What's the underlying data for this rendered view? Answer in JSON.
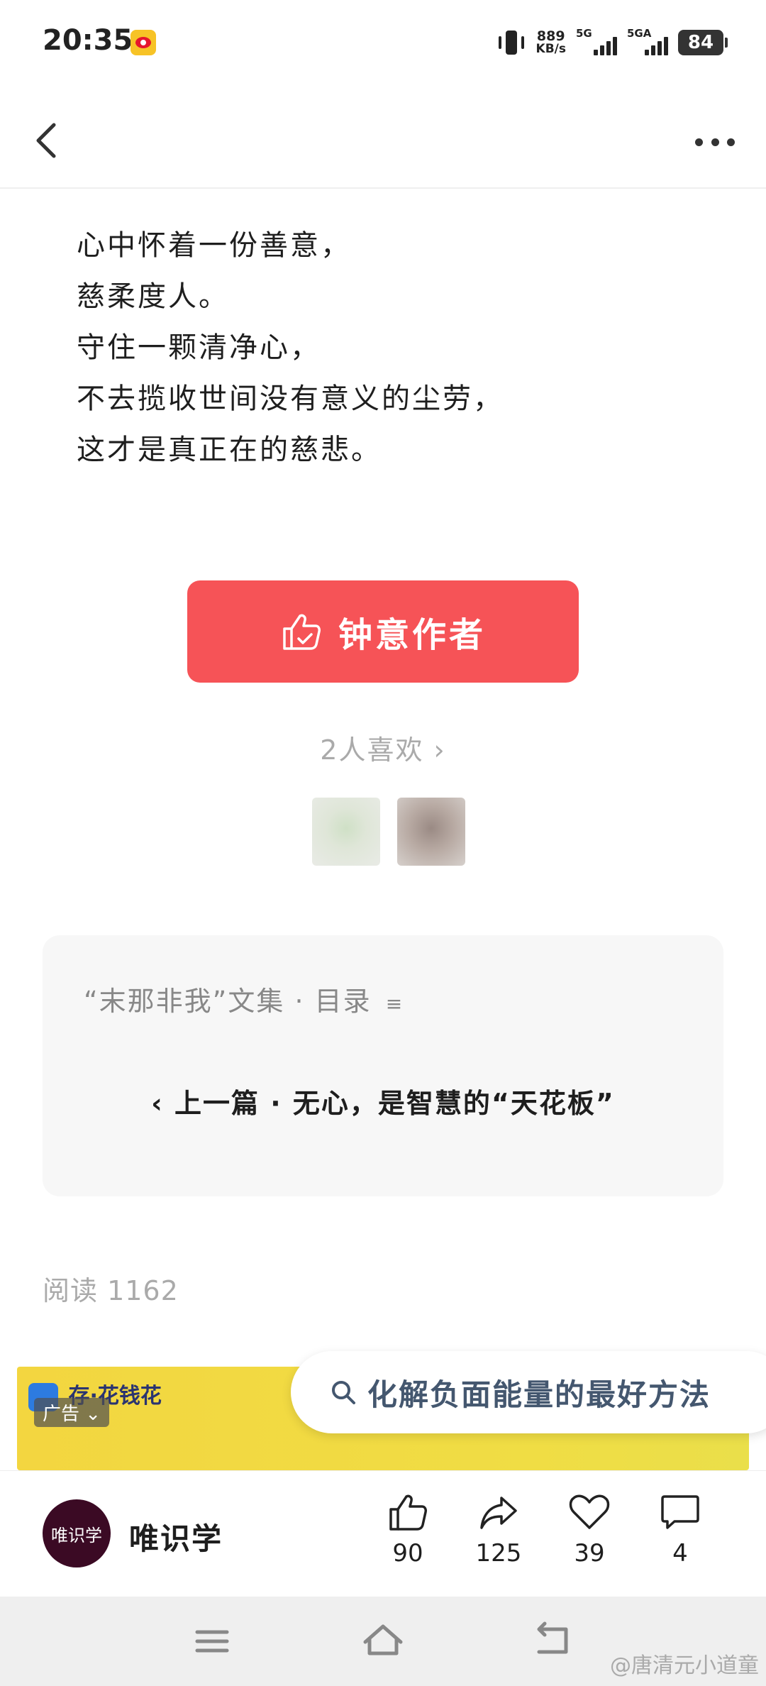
{
  "status_bar": {
    "time": "20:35",
    "net_speed_value": "889",
    "net_speed_unit": "KB/s",
    "sim1_label": "5G",
    "sim2_label": "5GA",
    "battery": "84",
    "notification_icon": "weibo-icon"
  },
  "header": {
    "back_icon": "chevron-left-icon",
    "more_icon": "more-dots-icon"
  },
  "article": {
    "lines": [
      "心中怀着一份善意，",
      "慈柔度人。",
      "守住一颗清净心，",
      "不去揽收世间没有意义的尘劳，",
      "这才是真正在的慈悲。"
    ]
  },
  "like_author": {
    "label": "钟意作者",
    "color": "#f65357"
  },
  "likes": {
    "text": "2人喜欢 ›"
  },
  "collection": {
    "title": "“末那非我”文集 · 目录",
    "title_icon": "≡",
    "prev_article": "‹ 上一篇 · 无心，是智慧的“天花板”"
  },
  "read_count": "阅读 1162",
  "ad": {
    "brand": "存·花钱花",
    "tag": "广告 ⌄",
    "search_text": "化解负面能量的最好方法"
  },
  "author": {
    "avatar_text": "唯识学",
    "name": "唯识学"
  },
  "actions": {
    "like_count": "90",
    "share_count": "125",
    "favorite_count": "39",
    "comment_count": "4"
  },
  "watermark": "@唐清元小道童"
}
